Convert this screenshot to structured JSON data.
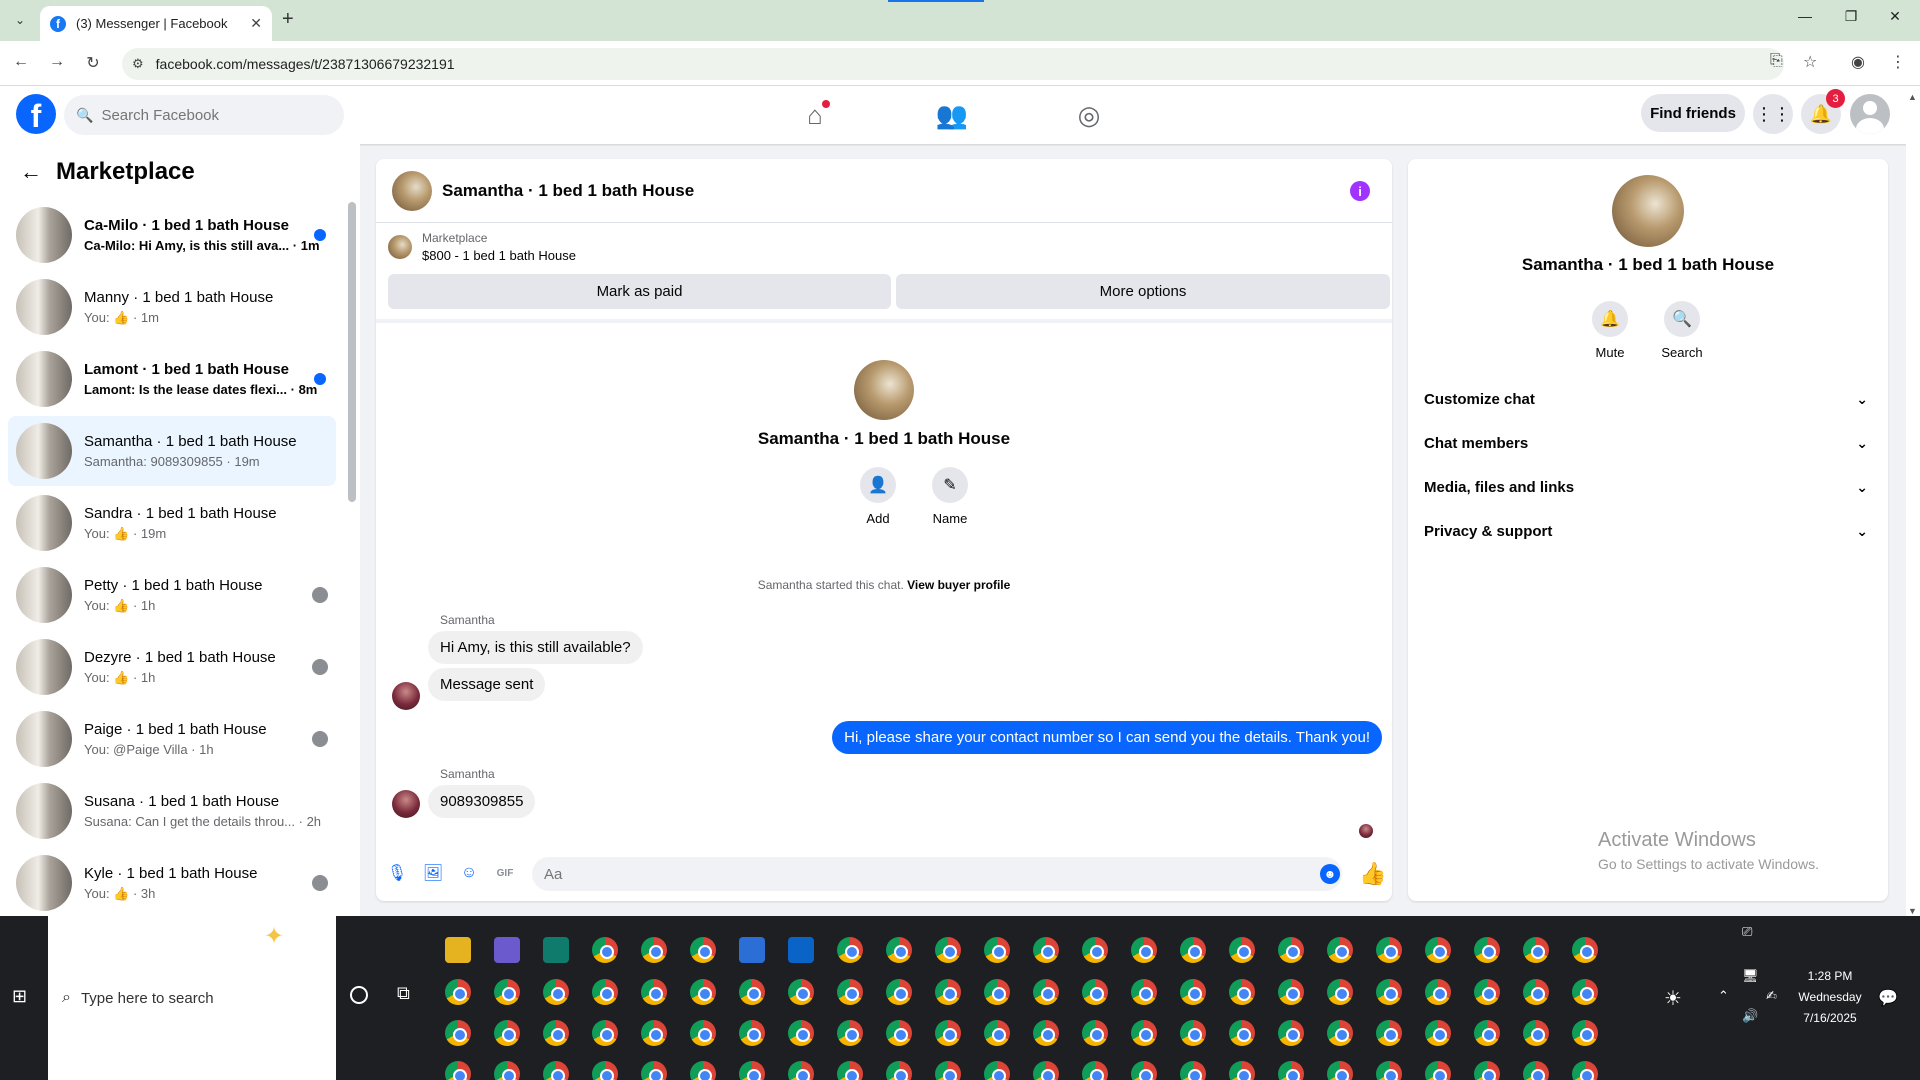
{
  "browser": {
    "tab_title": "(3) Messenger | Facebook",
    "url": "facebook.com/messages/t/23871306679232191"
  },
  "fb_header": {
    "search_placeholder": "Search Facebook",
    "find_friends": "Find friends",
    "notifications_count": "3"
  },
  "sidebar": {
    "title": "Marketplace",
    "conversations": [
      {
        "name": "Ca-Milo · 1 bed 1 bath House",
        "preview": "Ca-Milo: Hi Amy, is this still ava... · 1m",
        "unread": true,
        "indicator": "blue-dot"
      },
      {
        "name": "Manny · 1 bed 1 bath House",
        "preview": "You: 👍 · 1m",
        "unread": false,
        "indicator": ""
      },
      {
        "name": "Lamont · 1 bed 1 bath House",
        "preview": "Lamont: Is the lease dates flexi... · 8m",
        "unread": true,
        "indicator": "blue-dot"
      },
      {
        "name": "Samantha · 1 bed 1 bath House",
        "preview": "Samantha: 9089309855 · 19m",
        "unread": false,
        "indicator": "",
        "active": true
      },
      {
        "name": "Sandra · 1 bed 1 bath House",
        "preview": "You: 👍 · 19m",
        "unread": false,
        "indicator": ""
      },
      {
        "name": "Petty · 1 bed 1 bath House",
        "preview": "You: 👍 · 1h",
        "unread": false,
        "indicator": "seen-avatar"
      },
      {
        "name": "Dezyre · 1 bed 1 bath House",
        "preview": "You: 👍 · 1h",
        "unread": false,
        "indicator": "seen-avatar"
      },
      {
        "name": "Paige · 1 bed 1 bath House",
        "preview": "You: @Paige Villa · 1h",
        "unread": false,
        "indicator": "seen-avatar"
      },
      {
        "name": "Susana · 1 bed 1 bath House",
        "preview": "Susana: Can I get the details throu... · 2h",
        "unread": false,
        "indicator": ""
      },
      {
        "name": "Kyle · 1 bed 1 bath House",
        "preview": "You: 👍 · 3h",
        "unread": false,
        "indicator": "seen-avatar"
      }
    ]
  },
  "chat": {
    "header_name": "Samantha · 1 bed 1 bath House",
    "marketplace_label": "Marketplace",
    "listing": "$800 - 1 bed 1 bath House",
    "mark_paid": "Mark as paid",
    "more_options": "More options",
    "profile_name": "Samantha · 1 bed 1 bath House",
    "add_label": "Add",
    "name_label": "Name",
    "started_text": "Samantha started this chat.",
    "view_profile": "View buyer profile",
    "messages": {
      "sender1": "Samantha",
      "msg1": "Hi Amy, is this still available?",
      "msg2": "Message sent",
      "msg_out": "Hi, please share your contact number so I can send you the details. Thank you!",
      "sender2": "Samantha",
      "msg3": "9089309855"
    },
    "input_placeholder": "Aa"
  },
  "info_panel": {
    "name": "Samantha · 1 bed 1 bath House",
    "mute": "Mute",
    "search": "Search",
    "sections": [
      "Customize chat",
      "Chat members",
      "Media, files and links",
      "Privacy & support"
    ],
    "watermark_title": "Activate Windows",
    "watermark_sub": "Go to Settings to activate Windows."
  },
  "taskbar": {
    "search_placeholder": "Type here to search",
    "time": "1:28 PM",
    "day": "Wednesday",
    "date": "7/16/2025"
  },
  "colors": {
    "fb_blue": "#0866ff",
    "active_row": "#ebf5ff",
    "badge_red": "#e41e3f",
    "info_purple": "#a033ff"
  }
}
